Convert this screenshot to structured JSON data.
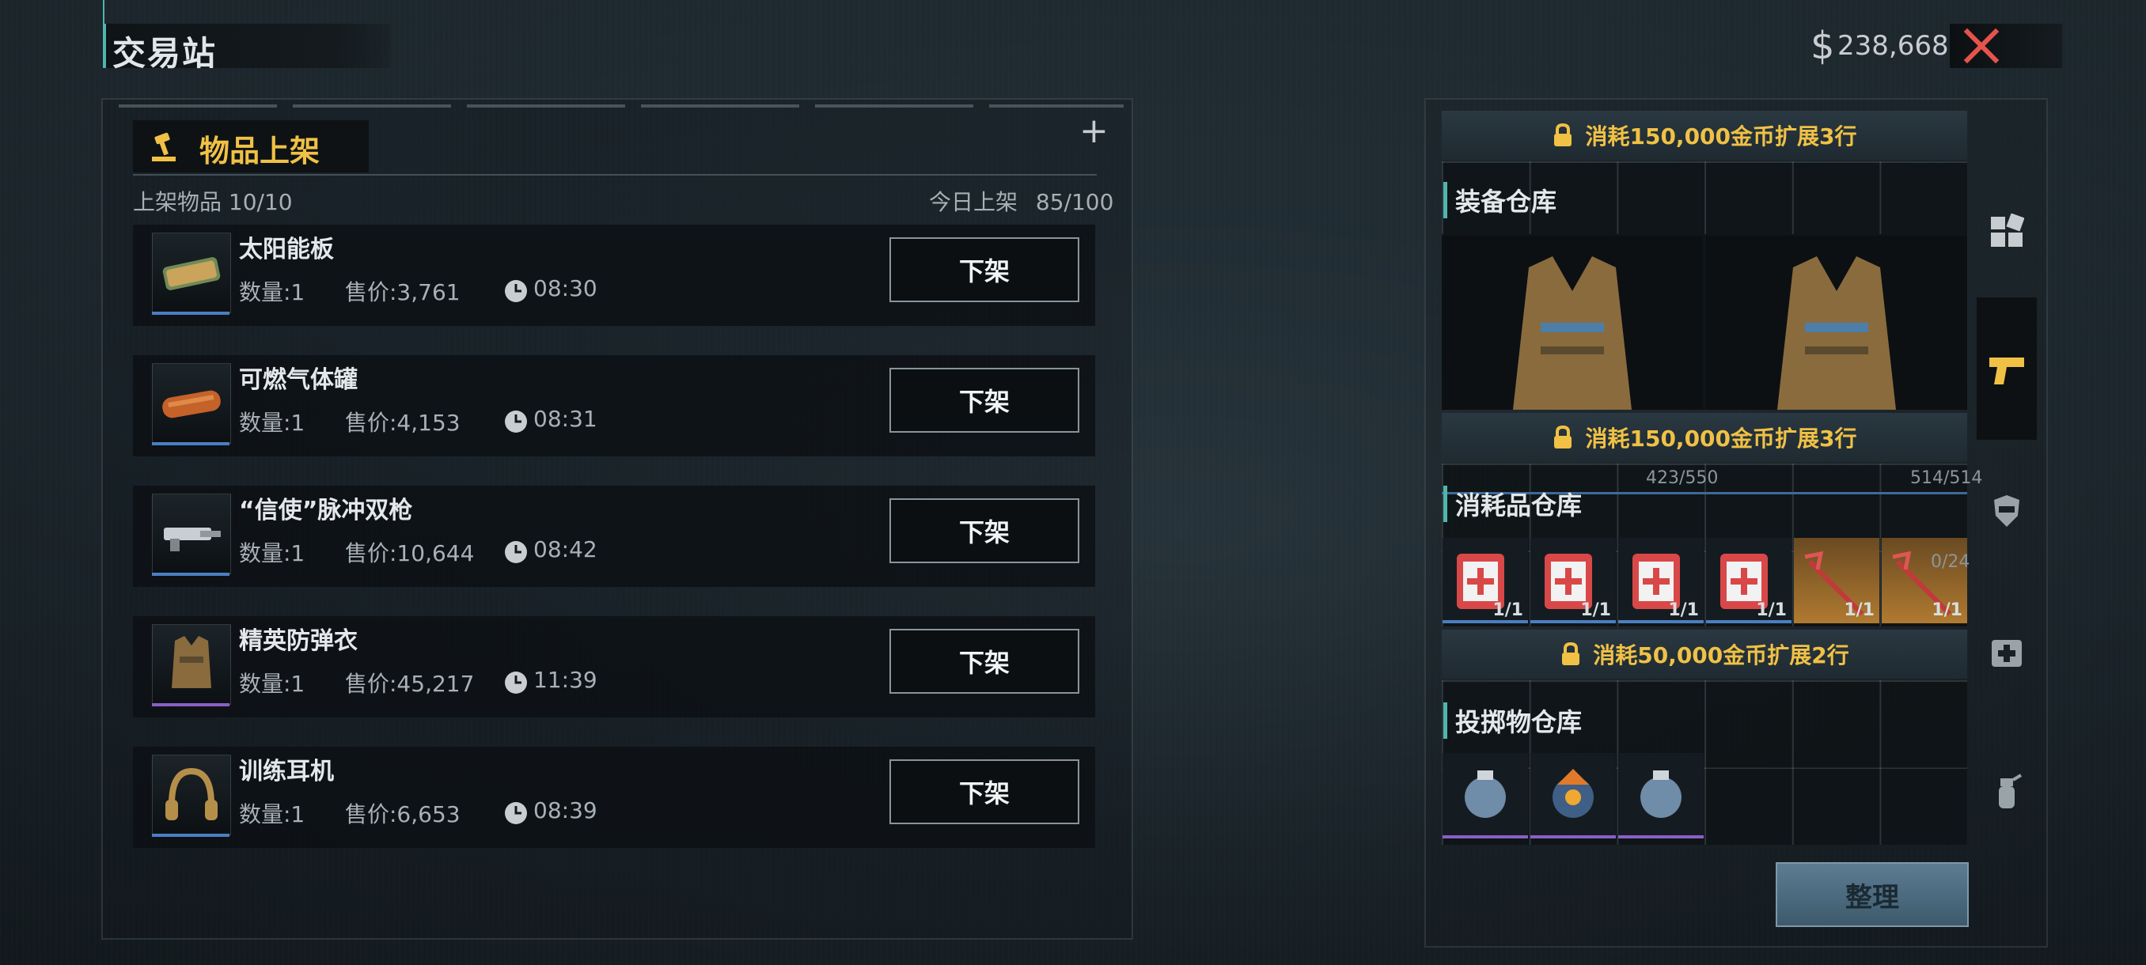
{
  "header": {
    "title": "交易站",
    "money": "238,668",
    "money_symbol": "$"
  },
  "listing_panel": {
    "title": "物品上架",
    "listed_label": "上架物品 10/10",
    "today_label": "今日上架",
    "today_value": "85/100",
    "delist_label": "下架",
    "items": [
      {
        "name": "太阳能板",
        "qty": "数量:1",
        "price": "售价:3,761",
        "time": "08:30",
        "rarity_color": "#4a7fc1"
      },
      {
        "name": "可燃气体罐",
        "qty": "数量:1",
        "price": "售价:4,153",
        "time": "08:31",
        "rarity_color": "#4a7fc1"
      },
      {
        "name": "“信使”脉冲双枪",
        "qty": "数量:1",
        "price": "售价:10,644",
        "time": "08:42",
        "rarity_color": "#4a7fc1"
      },
      {
        "name": "精英防弹衣",
        "qty": "数量:1",
        "price": "售价:45,217",
        "time": "11:39",
        "rarity_color": "#8a5fc8"
      },
      {
        "name": "训练耳机",
        "qty": "数量:1",
        "price": "售价:6,653",
        "time": "08:39",
        "rarity_color": "#4a7fc1"
      }
    ]
  },
  "warehouse": {
    "unlock_1": "消耗150,000金币扩展3行",
    "unlock_2": "消耗150,000金币扩展3行",
    "unlock_3": "消耗50,000金币扩展2行",
    "equipment_title": "装备仓库",
    "consumable_title": "消耗品仓库",
    "consumable_cap_1": "423/550",
    "consumable_cap_2": "514/514",
    "consumable_cap_3": "0/24",
    "consumable_slots": [
      "1/1",
      "1/1",
      "1/1",
      "1/1",
      "1/1",
      "1/1"
    ],
    "throwable_title": "投掷物仓库",
    "sort_label": "整理"
  },
  "side_tabs": [
    "grid-icon",
    "pistol-icon",
    "helmet-icon",
    "medkit-icon",
    "grenade-icon"
  ]
}
